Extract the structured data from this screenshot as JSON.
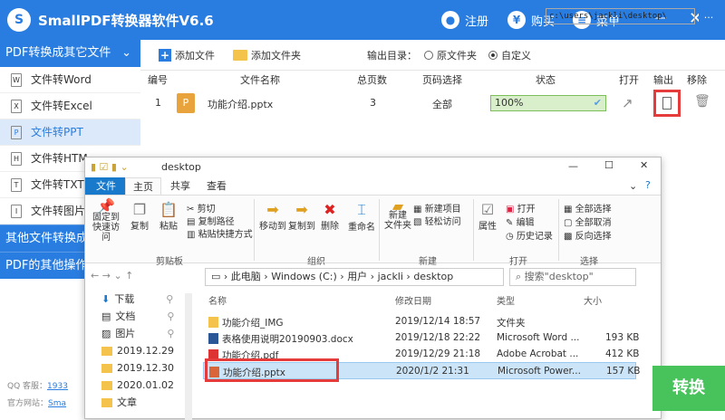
{
  "header": {
    "title": "SmallPDF转换器软件V6.6",
    "register": "注册",
    "buy": "购买",
    "menu": "菜单"
  },
  "sidebar": {
    "section_title": "PDF转换成其它文件",
    "items": [
      {
        "label": "文件转Word",
        "icon": "word-icon"
      },
      {
        "label": "文件转Excel",
        "icon": "excel-icon"
      },
      {
        "label": "文件转PPT",
        "icon": "ppt-icon"
      },
      {
        "label": "文件转HTM",
        "icon": "html-icon"
      },
      {
        "label": "文件转TXT",
        "icon": "txt-icon"
      },
      {
        "label": "文件转图片",
        "icon": "image-icon"
      }
    ],
    "other_conversion": "其他文件转换成",
    "pdf_other": "PDF的其他操作",
    "qq_label": "QQ 客服：",
    "qq_value": "1933",
    "site_label": "官方网站：",
    "site_value": "Sma"
  },
  "toolbar": {
    "add_file": "添加文件",
    "add_folder": "添加文件夹",
    "output_label": "输出目录：",
    "opt_original": "原文件夹",
    "opt_custom": "自定义",
    "output_path": "c:\\users\\jackli\\desktop\\",
    "browse": "..."
  },
  "table": {
    "headers": {
      "no": "编号",
      "name": "文件名称",
      "pages": "总页数",
      "page_select": "页码选择",
      "status": "状态",
      "open": "打开",
      "output": "输出",
      "remove": "移除"
    },
    "rows": [
      {
        "no": "1",
        "name": "功能介绍.pptx",
        "pages": "3",
        "page_select": "全部",
        "progress_text": "100%",
        "progress": 1.0
      }
    ]
  },
  "explorer": {
    "title": "desktop",
    "tabs": [
      "文件",
      "主页",
      "共享",
      "查看"
    ],
    "ribbon": {
      "pin": "固定到\n快速访问",
      "copy": "复制",
      "paste": "粘贴",
      "cut": "剪切",
      "copy_path": "复制路径",
      "paste_shortcut": "粘贴快捷方式",
      "clipboard": "剪贴板",
      "move_to": "移动到",
      "copy_to": "复制到",
      "delete": "删除",
      "rename": "重命名",
      "organize": "组织",
      "new_folder": "新建\n文件夹",
      "new_item": "新建项目",
      "easy_access": "轻松访问",
      "new": "新建",
      "properties": "属性",
      "open": "打开",
      "edit": "编辑",
      "history": "历史记录",
      "open_group": "打开",
      "select_all": "全部选择",
      "select_none": "全部取消",
      "invert": "反向选择",
      "select": "选择"
    },
    "address": [
      "此电脑",
      "Windows (C:)",
      "用户",
      "jackli",
      "desktop"
    ],
    "search_placeholder": "搜索\"desktop\"",
    "nav": [
      "下载",
      "文档",
      "图片",
      "2019.12.29",
      "2019.12.30",
      "2020.01.02",
      "文章"
    ],
    "columns": {
      "name": "名称",
      "date": "修改日期",
      "type": "类型",
      "size": "大小"
    },
    "files": [
      {
        "name": "功能介绍_IMG",
        "date": "2019/12/14 18:57",
        "type": "文件夹",
        "size": ""
      },
      {
        "name": "表格使用说明20190903.docx",
        "date": "2019/12/18 22:22",
        "type": "Microsoft Word ...",
        "size": "193 KB"
      },
      {
        "name": "功能介绍.pdf",
        "date": "2019/12/29 21:18",
        "type": "Adobe Acrobat ...",
        "size": "412 KB"
      },
      {
        "name": "功能介绍.pptx",
        "date": "2020/1/2 21:31",
        "type": "Microsoft Power...",
        "size": "157 KB"
      }
    ]
  },
  "convert_button": "转换"
}
